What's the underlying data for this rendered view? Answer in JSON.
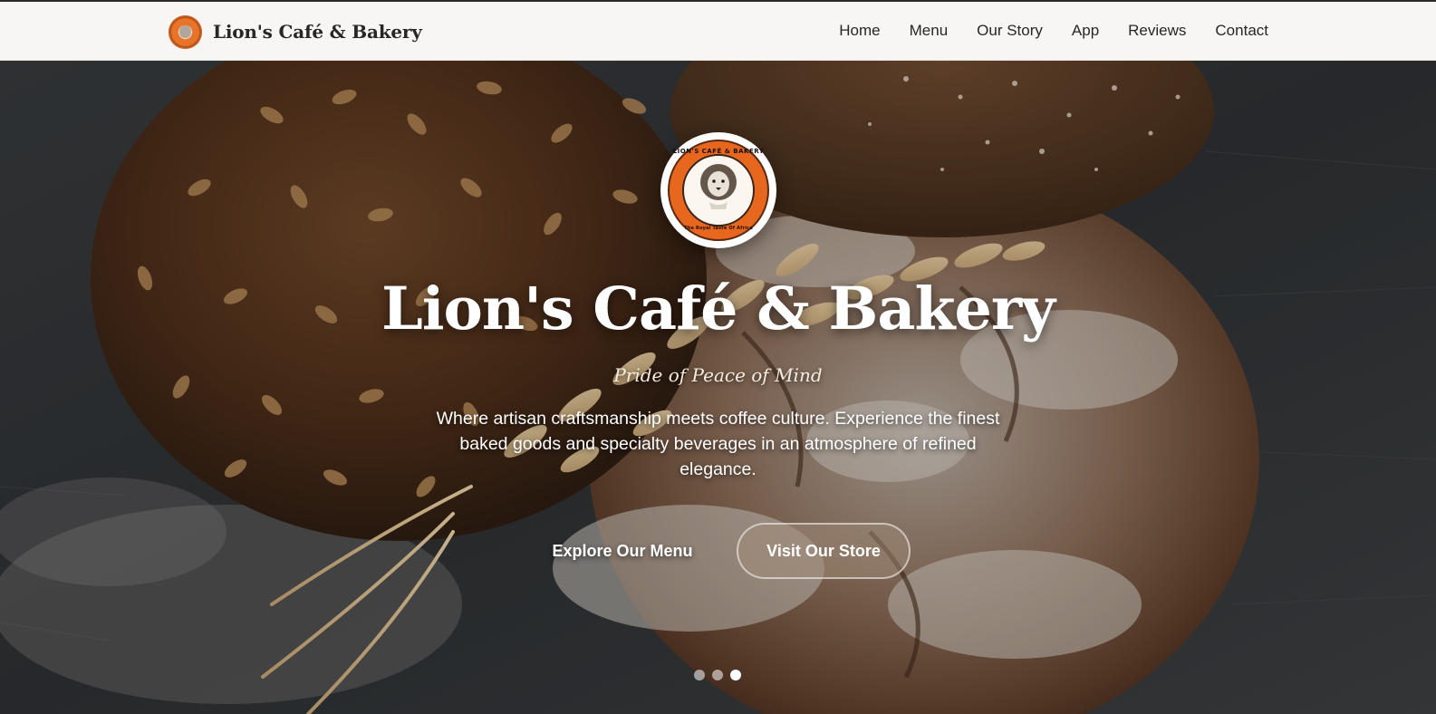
{
  "brand": {
    "name": "Lion's Café & Bakery",
    "logo_icon": "lion-cafe-logo-icon"
  },
  "nav": {
    "links": [
      {
        "label": "Home"
      },
      {
        "label": "Menu"
      },
      {
        "label": "Our Story"
      },
      {
        "label": "App"
      },
      {
        "label": "Reviews"
      },
      {
        "label": "Contact"
      }
    ]
  },
  "hero": {
    "logo_text_top": "LION'S CAFÉ & BAKERY",
    "logo_text_bottom": "The Royal Taste Of Africa",
    "title": "Lion's Café & Bakery",
    "tagline": "Pride of Peace of Mind",
    "description": "Where artisan craftsmanship meets coffee culture. Experience the finest baked goods and specialty beverages in an atmosphere of refined elegance.",
    "primary_button": "Explore Our Menu",
    "secondary_button": "Visit Our Store",
    "slides": {
      "count": 3,
      "active_index": 2
    }
  },
  "colors": {
    "accent_orange": "#e8671f",
    "nav_background": "#f7f6f4",
    "text_dark": "#2a2623"
  }
}
